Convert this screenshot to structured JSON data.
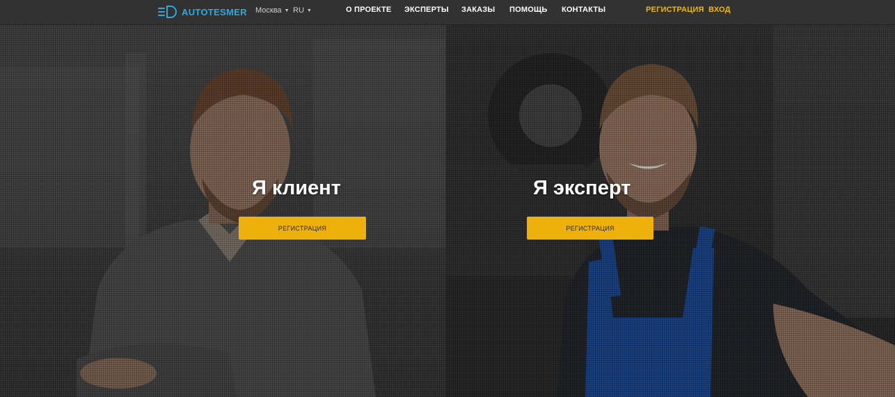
{
  "header": {
    "logo_text": "AUTOTESMER",
    "city": "Москва",
    "language": "RU",
    "nav": {
      "about": "О ПРОЕКТЕ",
      "experts": "ЭКСПЕРТЫ",
      "orders": "ЗАКАЗЫ",
      "help": "ПОМОЩЬ",
      "contacts": "КОНТАКТЫ"
    },
    "auth": {
      "register": "РЕГИСТРАЦИЯ",
      "login": "ВХОД"
    }
  },
  "hero": {
    "client": {
      "title": "Я клиент",
      "button": "РЕГИСТРАЦИЯ"
    },
    "expert": {
      "title": "Я эксперт",
      "button": "РЕГИСТРАЦИЯ"
    }
  },
  "colors": {
    "brand": "#2ea9df",
    "accent": "#edb00d",
    "header_bg": "#323232"
  },
  "icons": {
    "logo": "headlight-logo-icon",
    "dropdown": "caret-down-icon"
  }
}
